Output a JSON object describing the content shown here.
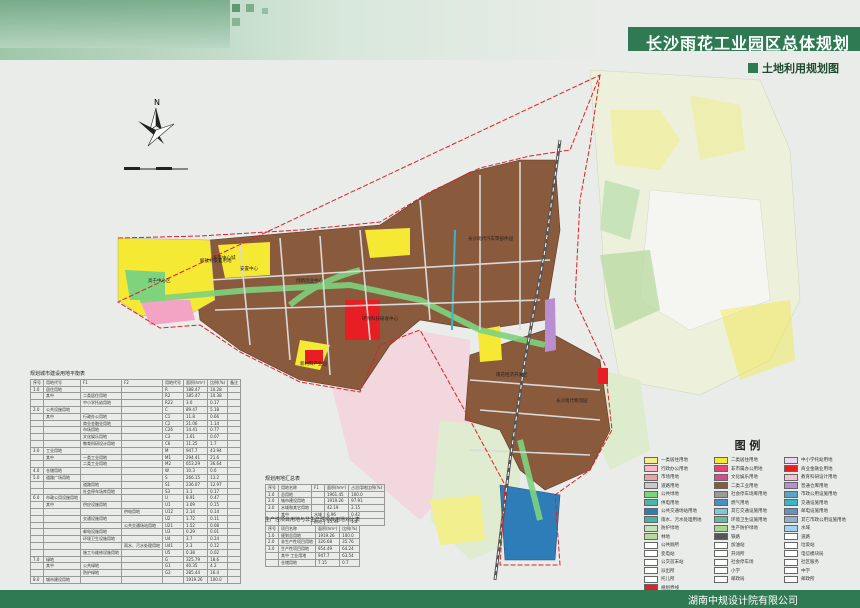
{
  "header": {
    "title": "长沙雨花工业园区总体规划",
    "subtitle": "土地利用规划图"
  },
  "footer": {
    "text": "湖南中规设计院有限公司"
  },
  "compass": {
    "north_label": "N"
  },
  "map_labels": [
    "东景中心城",
    "解放村安置用地",
    "安置中心",
    "高于中心区",
    "创新创业中心",
    "环保科技研发中心",
    "新材料产业园",
    "长沙现代汽车零部件园",
    "雨花经济开发区",
    "长沙现代物流园"
  ],
  "table1": {
    "title": "规划城市建设用地平衡表",
    "headers": [
      "序号",
      "用地代号",
      "F1",
      "F2",
      "用地代号",
      "面积(hm²)",
      "比例(%)",
      "备注"
    ],
    "rows": [
      [
        "1.0",
        "居住用地",
        "",
        "",
        "R",
        "188.47",
        "10.28",
        ""
      ],
      [
        "",
        "其中",
        "二类居住用地",
        "",
        "R2",
        "185.47",
        "10.38",
        ""
      ],
      [
        "",
        "",
        "中小学托幼用地",
        "",
        "R22",
        "3.0",
        "0.17",
        ""
      ],
      [
        "2.0",
        "公共设施用地",
        "",
        "",
        "C",
        "89.47",
        "5.18",
        ""
      ],
      [
        "",
        "其中",
        "行政办公用地",
        "",
        "C1",
        "11.8",
        "0.66",
        ""
      ],
      [
        "",
        "",
        "商业金融业用地",
        "",
        "C2",
        "21.06",
        "1.14",
        ""
      ],
      [
        "",
        "",
        "市场用地",
        "",
        "C26",
        "14.41",
        "0.77",
        ""
      ],
      [
        "",
        "",
        "文化娱乐用地",
        "",
        "C3",
        "1.61",
        "0.07",
        ""
      ],
      [
        "",
        "",
        "教育科研设计用地",
        "",
        "C6",
        "11.25",
        "1.7",
        ""
      ],
      [
        "3.0",
        "工业用地",
        "",
        "",
        "M",
        "947.7",
        "43.94",
        ""
      ],
      [
        "",
        "其中",
        "一类工业用地",
        "",
        "M1",
        "294.41",
        "21.6",
        ""
      ],
      [
        "",
        "",
        "二类工业用地",
        "",
        "M2",
        "653.29",
        "36.64",
        ""
      ],
      [
        "4.0",
        "仓储用地",
        "",
        "",
        "W",
        "10.3",
        "0.6",
        ""
      ],
      [
        "5.0",
        "道路广场用地",
        "",
        "",
        "S",
        "266.15",
        "13.2",
        ""
      ],
      [
        "",
        "",
        "道路用地",
        "",
        "S1",
        "236.07",
        "12.97",
        ""
      ],
      [
        "",
        "",
        "社会停车场库用地",
        "",
        "S3",
        "3.1",
        "0.17",
        ""
      ],
      [
        "6.0",
        "市政公用设施用地",
        "",
        "",
        "U",
        "8.91",
        "0.47",
        ""
      ],
      [
        "",
        "其中",
        "供应设施用地",
        "",
        "U1",
        "3.09",
        "0.15",
        ""
      ],
      [
        "",
        "",
        "",
        "供电用地",
        "U12",
        "2.14",
        "0.14",
        ""
      ],
      [
        "",
        "",
        "交通设施用地",
        "",
        "U2",
        "1.72",
        "0.11",
        ""
      ],
      [
        "",
        "",
        "",
        "公共交通场站用地",
        "U21",
        "1.52",
        "0.08",
        ""
      ],
      [
        "",
        "",
        "邮电设施用地",
        "",
        "U3",
        "0.29",
        "0.01",
        ""
      ],
      [
        "",
        "",
        "环境卫生设施用地",
        "",
        "U4",
        "3.7",
        "0.24",
        ""
      ],
      [
        "",
        "",
        "",
        "雨水、污水处理用地",
        "U41",
        "2.3",
        "0.12",
        ""
      ],
      [
        "",
        "",
        "施工与维修设施用地",
        "",
        "U5",
        "0.38",
        "0.02",
        ""
      ],
      [
        "7.0",
        "绿地",
        "",
        "",
        "G",
        "325.79",
        "18.6",
        ""
      ],
      [
        "",
        "其中",
        "公共绿地",
        "",
        "G1",
        "40.35",
        "4.2",
        ""
      ],
      [
        "",
        "",
        "防护绿地",
        "",
        "G2",
        "285.44",
        "16.4",
        ""
      ],
      [
        "8.0",
        "城市建设用地",
        "",
        "",
        "",
        "1919.26",
        "100.0",
        ""
      ]
    ]
  },
  "table2": {
    "title": "规划用地汇总表",
    "headers": [
      "序号",
      "用地名称",
      "F1",
      "面积(hm²)",
      "占总用地比例(%)"
    ],
    "rows": [
      [
        "1.0",
        "总用地",
        "",
        "1961.45",
        "100.0"
      ],
      [
        "2.0",
        "城市建设用地",
        "",
        "1919.26",
        "97.91"
      ],
      [
        "3.0",
        "水域和其它用地",
        "",
        "42.19",
        "2.15"
      ],
      [
        "",
        "其中",
        "水域",
        "6.96",
        "0.42"
      ],
      [
        "",
        "",
        "耕地",
        "15.39",
        "1.8"
      ]
    ]
  },
  "table3": {
    "title": "生产性项目用地与非生产性项目用地对比表",
    "headers": [
      "序号",
      "项目名称",
      "面积(hm²)",
      "比例(%)"
    ],
    "rows": [
      [
        "1.0",
        "规划总用地",
        "1919.26",
        "100.0"
      ],
      [
        "2.0",
        "非生产性项目用地",
        "326.68",
        "35.76"
      ],
      [
        "3.0",
        "生产性项目用地",
        "954.49",
        "64.24"
      ],
      [
        "",
        "其中 工业用地",
        "947.7",
        "63.54"
      ],
      [
        "",
        "仓储用地",
        "7.15",
        "0.7"
      ]
    ]
  },
  "legend": {
    "title": "图 例",
    "items": [
      {
        "label": "一类居住用地",
        "color": "#f2ef8e"
      },
      {
        "label": "二类居住用地",
        "color": "#f5e934"
      },
      {
        "label": "中小学托幼用地",
        "color": "#e8d9f0"
      },
      {
        "label": "行政办公用地",
        "color": "#f6b8c8"
      },
      {
        "label": "非市属办公用地",
        "color": "#e6427a"
      },
      {
        "label": "商业金融业用地",
        "color": "#e81e25"
      },
      {
        "label": "市场用地",
        "color": "#e8a3a3"
      },
      {
        "label": "文化娱乐用地",
        "color": "#d44b8e"
      },
      {
        "label": "教育科研设计用地",
        "color": "#f3c2d4"
      },
      {
        "label": "道路用地",
        "color": "#c9c9c9"
      },
      {
        "label": "二类工业用地",
        "color": "#8a5a3c"
      },
      {
        "label": "普通仓库用地",
        "color": "#b98fd1"
      },
      {
        "label": "公共绿地",
        "color": "#7ed37e"
      },
      {
        "label": "社会停车场库用地",
        "color": "#9a9a9a"
      },
      {
        "label": "市政公用设施用地",
        "color": "#5ba3c7"
      },
      {
        "label": "供电用地",
        "color": "#49b6a8"
      },
      {
        "label": "燃气用地",
        "color": "#4a8fbf"
      },
      {
        "label": "交通设施用地",
        "color": "#3cb3c6"
      },
      {
        "label": "公共交通场站用地",
        "color": "#2e7db8"
      },
      {
        "label": "其它交通设施用地",
        "color": "#7fc8d6"
      },
      {
        "label": "邮电设施用地",
        "color": "#6c8ebf"
      },
      {
        "label": "雨水、污水处理用地",
        "color": "#4cb0a3"
      },
      {
        "label": "环境卫生设施用地",
        "color": "#6bb8a0"
      },
      {
        "label": "其它市政公用设施用地",
        "color": "#8fb2c8"
      },
      {
        "label": "防护绿地",
        "color": "#c3e3b5"
      },
      {
        "label": "生产防护绿地",
        "color": "#a7d58f"
      },
      {
        "label": "水域",
        "color": "#9fd5f0"
      },
      {
        "label": "林地",
        "color": "#b5d99e"
      },
      {
        "label": "铁路",
        "color": "#555555"
      },
      {
        "label": "道路",
        "color": "#ffffff"
      },
      {
        "label": "公共厕所",
        "color": "#ffffff"
      },
      {
        "label": "加油站",
        "color": "#ffffff"
      },
      {
        "label": "垃圾站",
        "color": "#ffffff"
      },
      {
        "label": "变电站",
        "color": "#ffffff"
      },
      {
        "label": "开闭所",
        "color": "#ffffff"
      },
      {
        "label": "电信模块局",
        "color": "#ffffff"
      },
      {
        "label": "公交首末站",
        "color": "#ffffff"
      },
      {
        "label": "社会停车场",
        "color": "#ffffff"
      },
      {
        "label": "社区服务",
        "color": "#ffffff"
      },
      {
        "label": "派出所",
        "color": "#ffffff"
      },
      {
        "label": "小学",
        "color": "#ffffff"
      },
      {
        "label": "中学",
        "color": "#ffffff"
      },
      {
        "label": "托儿所",
        "color": "#ffffff"
      },
      {
        "label": "邮政局",
        "color": "#ffffff"
      },
      {
        "label": "邮政所",
        "color": "#ffffff"
      },
      {
        "label": "规划界线",
        "color": "#e0202a"
      }
    ]
  }
}
